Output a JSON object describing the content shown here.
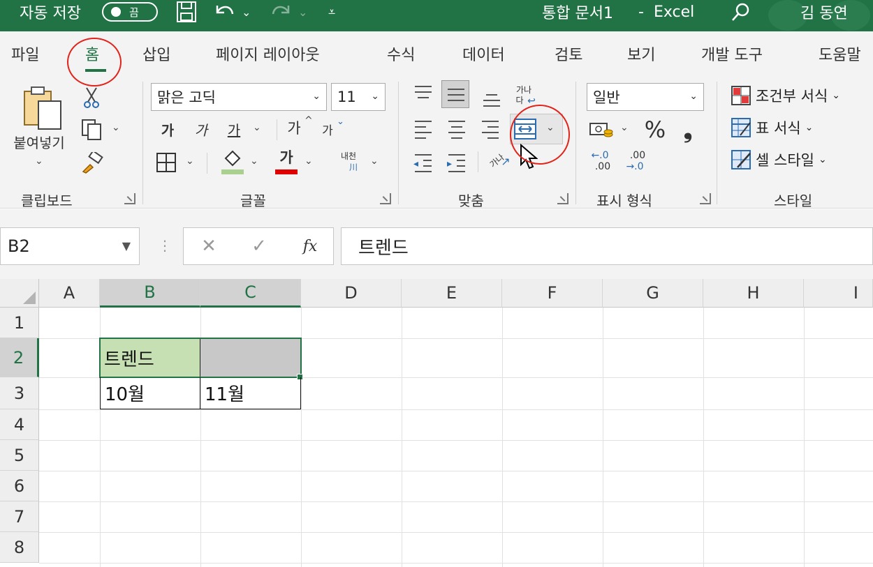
{
  "titlebar": {
    "autosave_label": "자동 저장",
    "autosave_state": "끔",
    "doc_title": "통합 문서1",
    "separator": "-",
    "app_name": "Excel",
    "user_name": "김 동연",
    "bg_color": "#217346"
  },
  "tabs": [
    {
      "label": "파일"
    },
    {
      "label": "홈"
    },
    {
      "label": "삽입"
    },
    {
      "label": "페이지 레이아웃"
    },
    {
      "label": "수식"
    },
    {
      "label": "데이터"
    },
    {
      "label": "검토"
    },
    {
      "label": "보기"
    },
    {
      "label": "개발 도구"
    },
    {
      "label": "도움말"
    }
  ],
  "ribbon": {
    "clipboard": {
      "label": "클립보드",
      "paste_label": "붙여넣기"
    },
    "font": {
      "label": "글꼴",
      "font_name": "맑은 고딕",
      "font_size": "11",
      "bold": "가",
      "italic": "가",
      "underline": "가",
      "grow": "가",
      "shrink": "가",
      "font_color_glyph": "가",
      "phonetic_top": "내천",
      "phonetic_bottom": "川",
      "font_color": "#e00000",
      "fill_color": "#a9d08e"
    },
    "alignment": {
      "label": "맞춤",
      "wrap_top": "가나",
      "wrap_bottom": "다",
      "orient_glyph": "가나"
    },
    "number": {
      "label": "표시 형식",
      "format": "일반",
      "percent": "%",
      "comma": "❟",
      "inc_top": "←.0",
      "inc_bottom": ".00",
      "dec_top": ".00",
      "dec_bottom": "→.0"
    },
    "styles": {
      "label": "스타일",
      "conditional": "조건부 서식",
      "table": "표 서식",
      "cell": "셀 스타일"
    }
  },
  "formula_bar": {
    "name_box": "B2",
    "content": "트렌드",
    "fx": "fx"
  },
  "sheet": {
    "columns": [
      "A",
      "B",
      "C",
      "D",
      "E",
      "F",
      "G",
      "H",
      "I"
    ],
    "rows": [
      "1",
      "2",
      "3",
      "4",
      "5",
      "6",
      "7",
      "8"
    ],
    "cells": {
      "B2": "트렌드",
      "B3": "10월",
      "C3": "11월"
    },
    "b2_fill": "#c6e0b4",
    "c2_fill": "#c8c8c8",
    "selection_color": "#217346"
  },
  "annotation_color": "#e2231a"
}
